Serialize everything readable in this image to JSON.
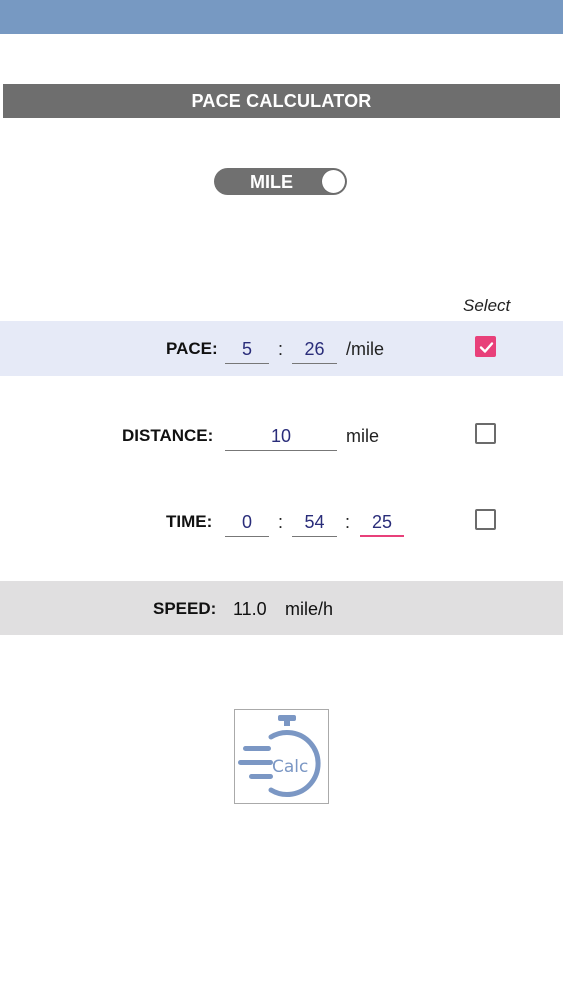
{
  "app": {
    "title": "PACE CALCULATOR",
    "unit_toggle": {
      "label": "MILE",
      "state": "on"
    },
    "select_header": "Select"
  },
  "rows": {
    "pace": {
      "label": "PACE:",
      "minutes": "5",
      "separator": ":",
      "seconds": "26",
      "unit": "/mile",
      "selected": true
    },
    "distance": {
      "label": "DISTANCE:",
      "value": "10",
      "unit": "mile",
      "selected": false
    },
    "time": {
      "label": "TIME:",
      "hours": "0",
      "sep1": ":",
      "minutes": "54",
      "sep2": ":",
      "seconds": "25",
      "selected": false
    }
  },
  "speed": {
    "label": "SPEED:",
    "value": "11.0",
    "unit": "mile/h"
  },
  "logo": {
    "text": "Calc"
  },
  "colors": {
    "statusbar": "#7799c2",
    "titlebar": "#6e6e6e",
    "accent": "#e8407a",
    "pace_row_bg": "#e6eaf7",
    "speed_row_bg": "#e0dfe0",
    "logo_color": "#7b97c4",
    "field_text": "#2a2d7a"
  },
  "icons": {
    "checkbox_checked": "checkmark-icon",
    "logo": "stopwatch-calc-logo"
  }
}
